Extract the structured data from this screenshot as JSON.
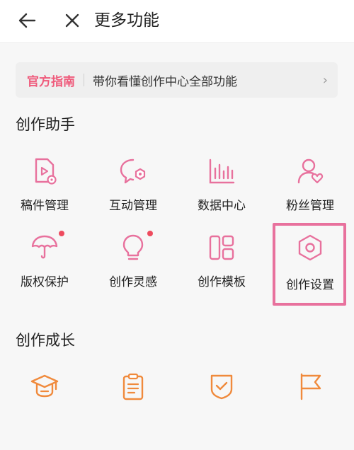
{
  "header": {
    "title": "更多功能"
  },
  "banner": {
    "tag": "官方指南",
    "text": "带你看懂创作中心全部功能",
    "chevron": "›"
  },
  "sections": [
    {
      "title": "创作助手",
      "items": [
        {
          "label": "稿件管理",
          "icon": "manuscript-icon"
        },
        {
          "label": "互动管理",
          "icon": "chat-bubble-icon"
        },
        {
          "label": "数据中心",
          "icon": "bar-chart-icon"
        },
        {
          "label": "粉丝管理",
          "icon": "user-heart-icon"
        },
        {
          "label": "版权保护",
          "icon": "umbrella-icon",
          "badge": true
        },
        {
          "label": "创作灵感",
          "icon": "lightbulb-icon",
          "badge": true
        },
        {
          "label": "创作模板",
          "icon": "template-icon"
        },
        {
          "label": "创作设置",
          "icon": "hexagon-settings-icon",
          "highlighted": true
        }
      ]
    },
    {
      "title": "创作成长",
      "items": [
        {
          "icon": "graduation-cap-icon"
        },
        {
          "icon": "clipboard-icon"
        },
        {
          "icon": "shield-check-icon"
        },
        {
          "icon": "flag-icon"
        }
      ]
    }
  ],
  "colors": {
    "pink_accent": "#e8719d",
    "orange_accent": "#f08a3c",
    "badge_red": "#ee4b5e"
  }
}
